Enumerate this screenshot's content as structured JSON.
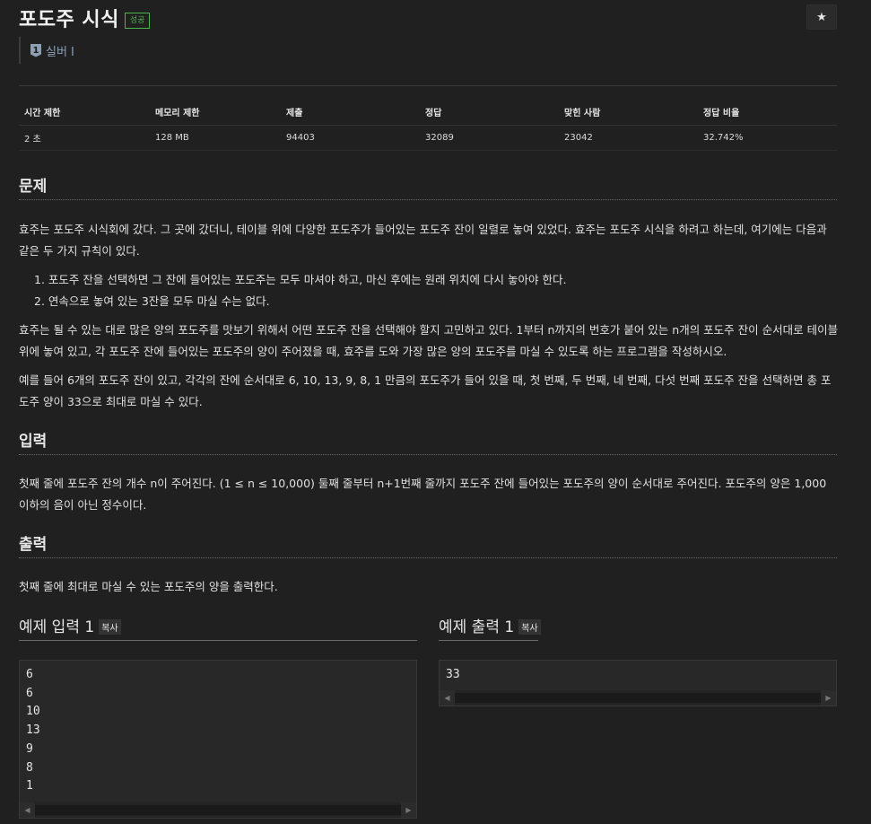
{
  "problem": {
    "title": "포도주 시식",
    "status_badge": "성공",
    "tier_number": "1",
    "tier_label": "실버 I",
    "star_icon": "★"
  },
  "info_table": {
    "headers": [
      "시간 제한",
      "메모리 제한",
      "제출",
      "정답",
      "맞힌 사람",
      "정답 비율"
    ],
    "values": [
      "2 초",
      "128 MB",
      "94403",
      "32089",
      "23042",
      "32.742%"
    ]
  },
  "sections": {
    "description_title": "문제",
    "description_p1": "효주는 포도주 시식회에 갔다. 그 곳에 갔더니, 테이블 위에 다양한 포도주가 들어있는 포도주 잔이 일렬로 놓여 있었다. 효주는 포도주 시식을 하려고 하는데, 여기에는 다음과 같은 두 가지 규칙이 있다.",
    "rules": [
      "1. 포도주 잔을 선택하면 그 잔에 들어있는 포도주는 모두 마셔야 하고, 마신 후에는 원래 위치에 다시 놓아야 한다.",
      "2. 연속으로 놓여 있는 3잔을 모두 마실 수는 없다."
    ],
    "description_p2": "효주는 될 수 있는 대로 많은 양의 포도주를 맛보기 위해서 어떤 포도주 잔을 선택해야 할지 고민하고 있다. 1부터 n까지의 번호가 붙어 있는 n개의 포도주 잔이 순서대로 테이블 위에 놓여 있고, 각 포도주 잔에 들어있는 포도주의 양이 주어졌을 때, 효주를 도와 가장 많은 양의 포도주를 마실 수 있도록 하는 프로그램을 작성하시오.",
    "description_p3": "예를 들어 6개의 포도주 잔이 있고, 각각의 잔에 순서대로 6, 10, 13, 9, 8, 1 만큼의 포도주가 들어 있을 때, 첫 번째, 두 번째, 네 번째, 다섯 번째 포도주 잔을 선택하면 총 포도주 양이 33으로 최대로 마실 수 있다.",
    "input_title": "입력",
    "input_text": "첫째 줄에 포도주 잔의 개수 n이 주어진다. (1 ≤ n ≤ 10,000) 둘째 줄부터 n+1번째 줄까지 포도주 잔에 들어있는 포도주의 양이 순서대로 주어진다. 포도주의 양은 1,000 이하의 음이 아닌 정수이다.",
    "output_title": "출력",
    "output_text": "첫째 줄에 최대로 마실 수 있는 포도주의 양을 출력한다."
  },
  "samples": {
    "input_title": "예제 입력 1",
    "output_title": "예제 출력 1",
    "copy_label": "복사",
    "input_lines": [
      "6",
      "6",
      "10",
      "13",
      "9",
      "8",
      "1"
    ],
    "output_lines": [
      "33"
    ],
    "scroll_left": "◀",
    "scroll_right": "▶"
  }
}
